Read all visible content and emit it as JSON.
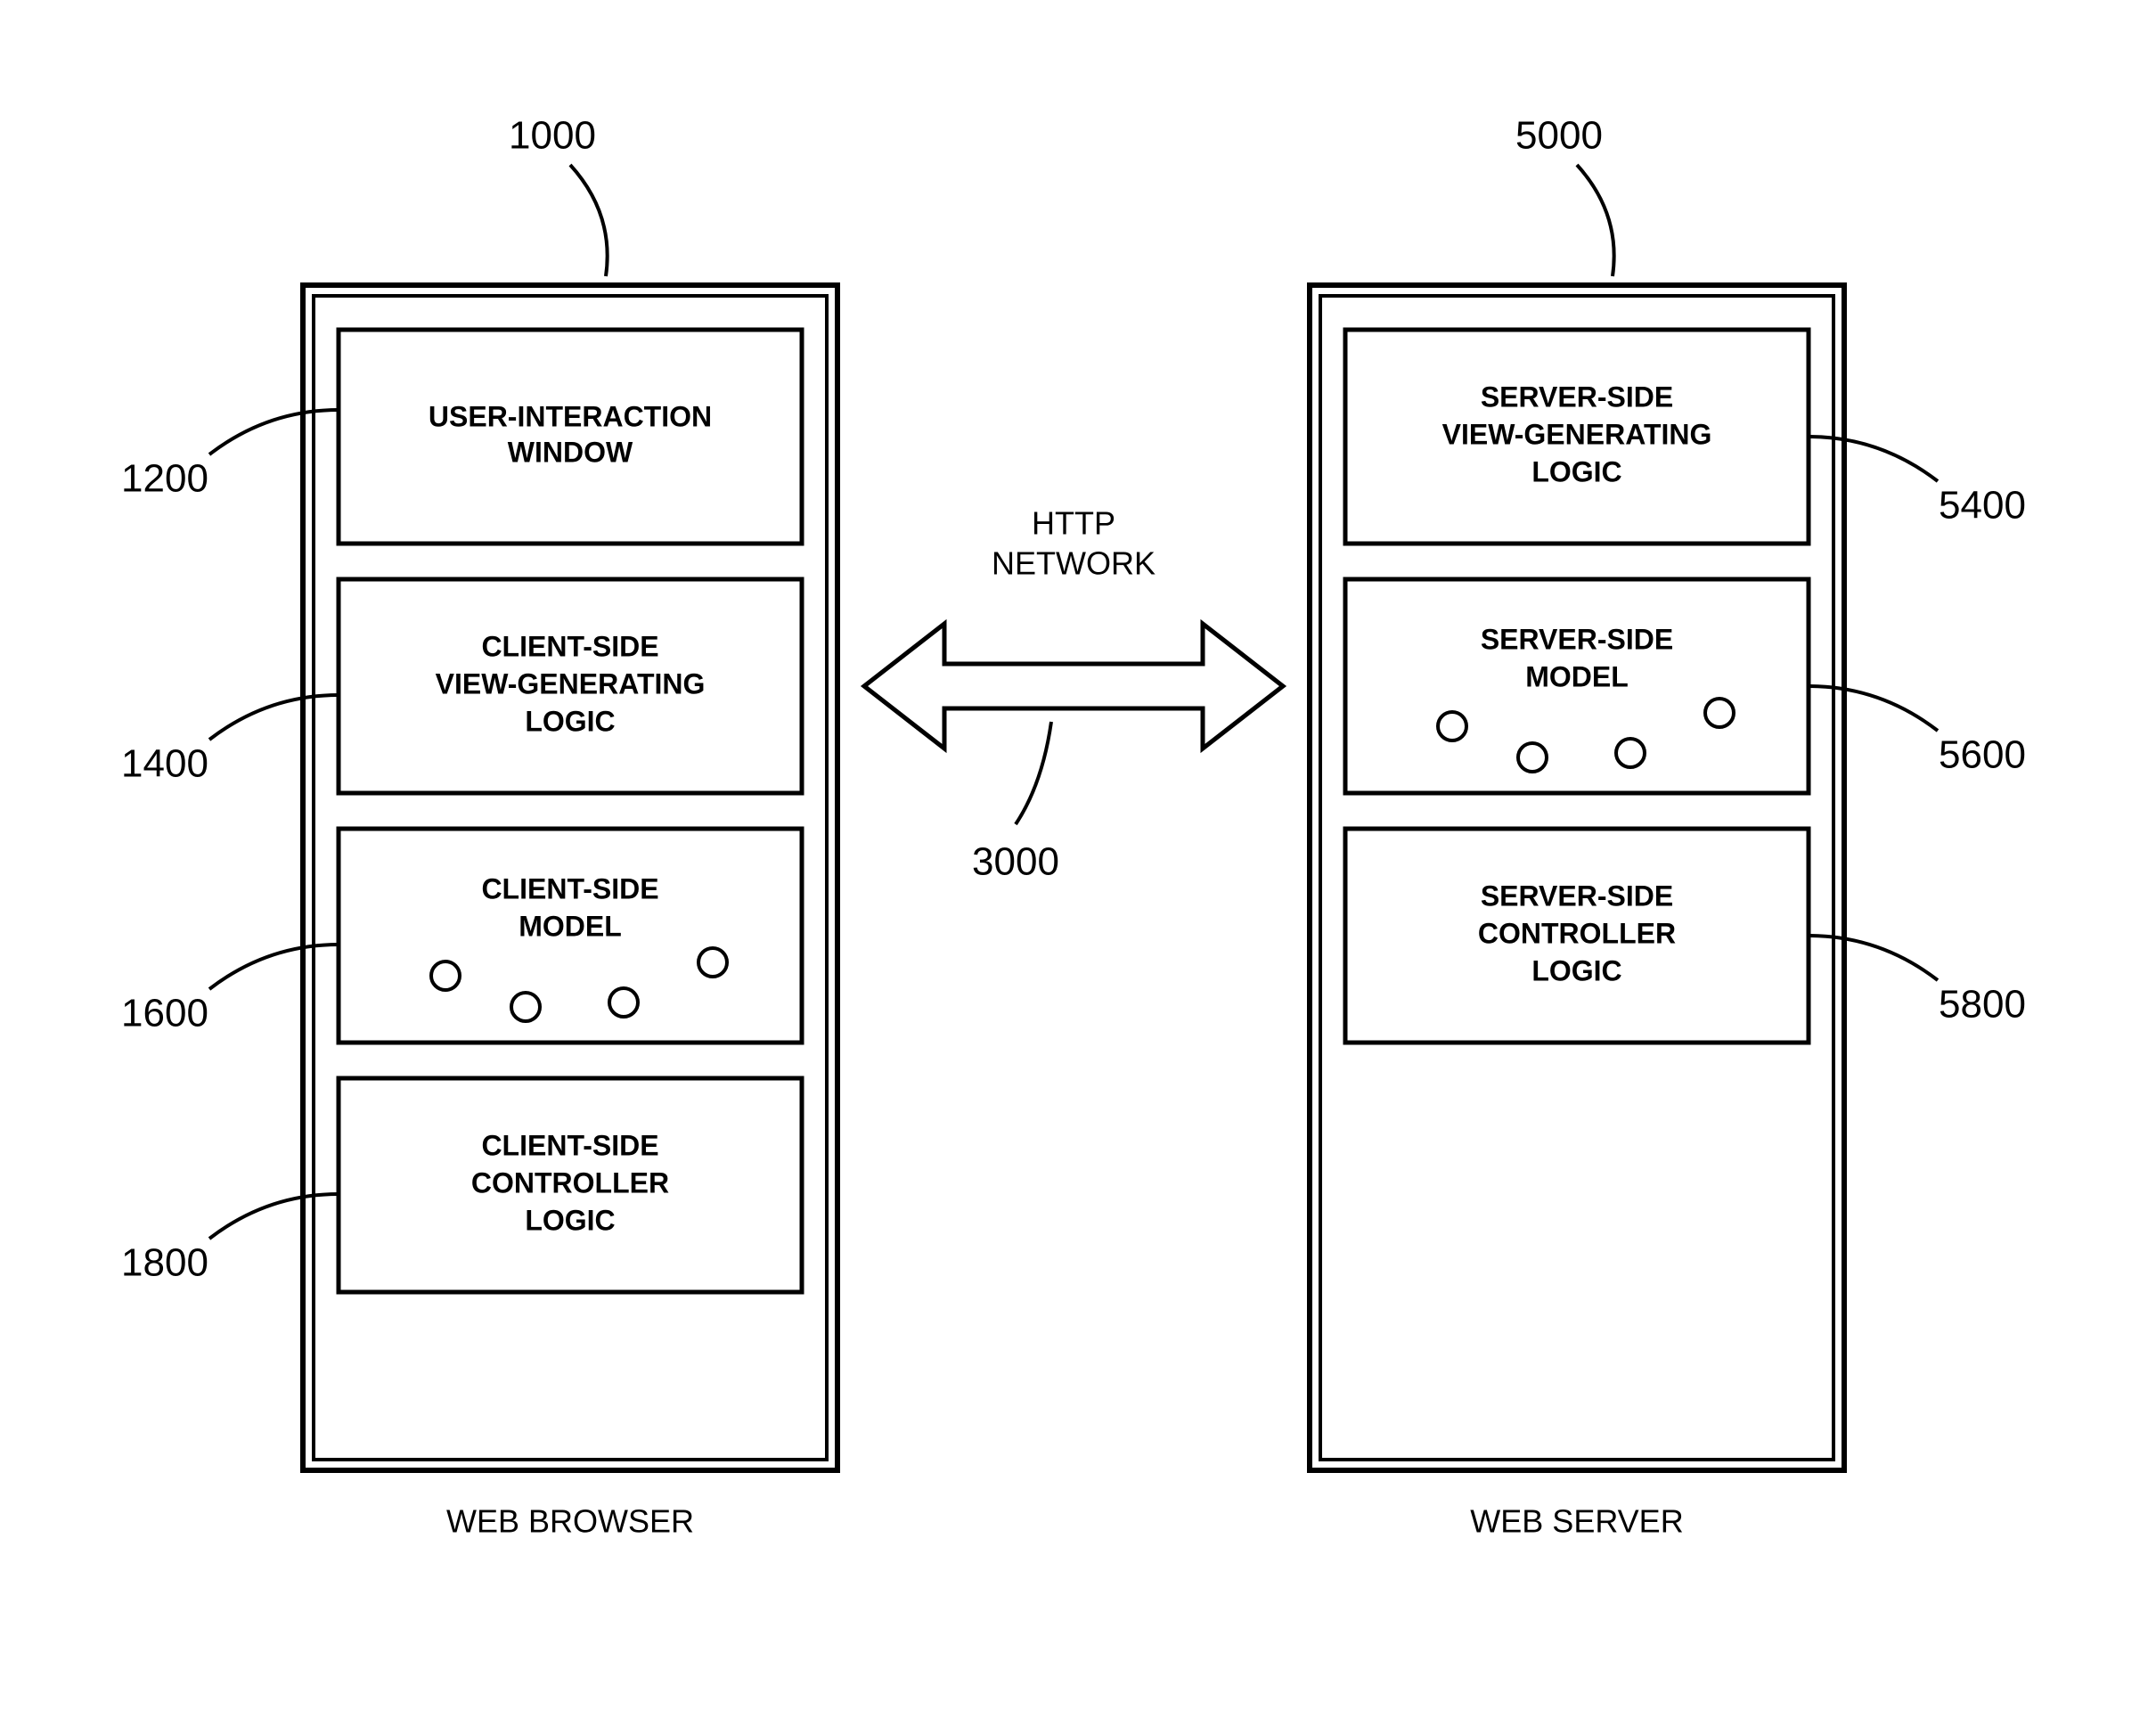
{
  "refs": {
    "browser": "1000",
    "server": "5000",
    "network": "3000",
    "browser_blocks": {
      "a": "1200",
      "b": "1400",
      "c": "1600",
      "d": "1800"
    },
    "server_blocks": {
      "a": "5400",
      "b": "5600",
      "c": "5800"
    }
  },
  "labels": {
    "browser": "WEB BROWSER",
    "server": "WEB SERVER",
    "network_line1": "HTTP",
    "network_line2": "NETWORK"
  },
  "browser_blocks": {
    "a": {
      "line1": "USER-INTERACTION",
      "line2": "WINDOW"
    },
    "b": {
      "line1": "CLIENT-SIDE",
      "line2": "VIEW-GENERATING",
      "line3": "LOGIC"
    },
    "c": {
      "line1": "CLIENT-SIDE",
      "line2": "MODEL"
    },
    "d": {
      "line1": "CLIENT-SIDE",
      "line2": "CONTROLLER",
      "line3": "LOGIC"
    }
  },
  "server_blocks": {
    "a": {
      "line1": "SERVER-SIDE",
      "line2": "VIEW-GENERATING",
      "line3": "LOGIC"
    },
    "b": {
      "line1": "SERVER-SIDE",
      "line2": "MODEL"
    },
    "c": {
      "line1": "SERVER-SIDE",
      "line2": "CONTROLLER",
      "line3": "LOGIC"
    }
  }
}
